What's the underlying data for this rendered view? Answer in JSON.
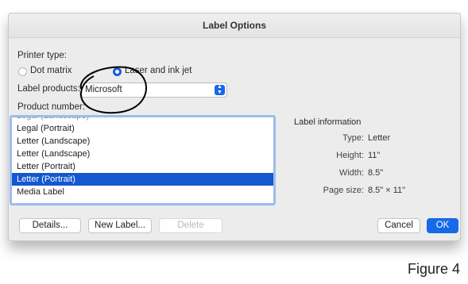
{
  "dialog": {
    "title": "Label Options"
  },
  "printer": {
    "heading": "Printer type:",
    "options": [
      {
        "label": "Dot matrix",
        "selected": false
      },
      {
        "label": "Laser and ink jet",
        "selected": true
      }
    ]
  },
  "label_products": {
    "label": "Label products:",
    "value": "Microsoft"
  },
  "product_number": {
    "label": "Product number:",
    "items": [
      "Legal (Landscape)",
      "Legal (Portrait)",
      "Letter (Landscape)",
      "Letter (Landscape)",
      "Letter (Portrait)",
      "Letter (Portrait)",
      "Media Label"
    ],
    "selected_index": 5
  },
  "label_information": {
    "heading": "Label information",
    "rows": [
      {
        "key": "Type:",
        "value": "Letter"
      },
      {
        "key": "Height:",
        "value": "11\""
      },
      {
        "key": "Width:",
        "value": "8.5\""
      },
      {
        "key": "Page size:",
        "value": "8.5\" × 11\""
      }
    ]
  },
  "buttons": {
    "details": "Details...",
    "new_label": "New Label...",
    "delete": "Delete",
    "cancel": "Cancel",
    "ok": "OK"
  },
  "figure_label": "Figure 4",
  "colors": {
    "accent": "#1669e8",
    "selection": "#1357d1",
    "annotation": "#000000"
  }
}
